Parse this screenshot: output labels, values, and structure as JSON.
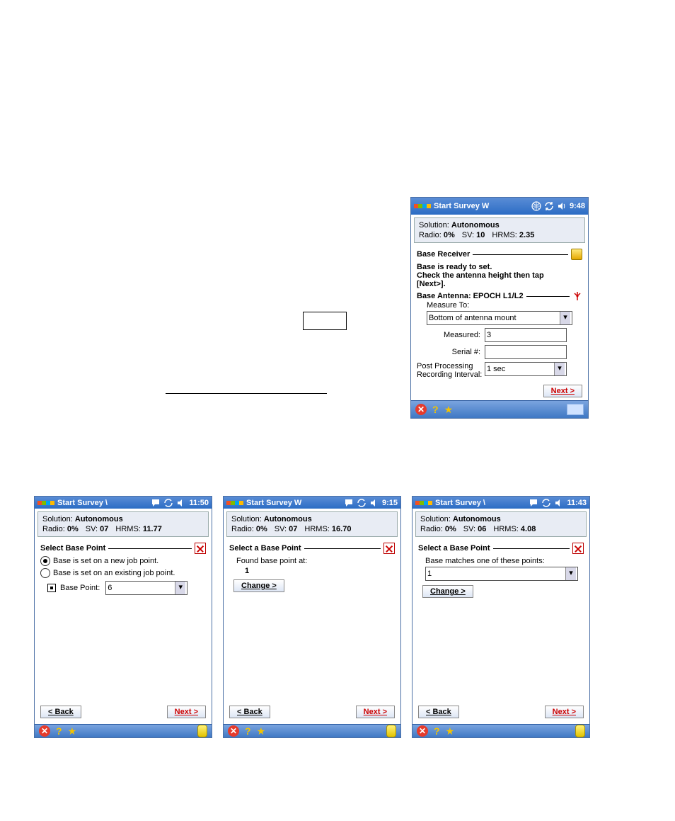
{
  "devices": {
    "top": {
      "title": "Start Survey W",
      "time": "9:48",
      "status": {
        "solution_label": "Solution:",
        "solution_value": "Autonomous",
        "radio_label": "Radio:",
        "radio_value": "0%",
        "sv_label": "SV:",
        "sv_value": "10",
        "hrms_label": "HRMS:",
        "hrms_value": "2.35"
      },
      "section1_title": "Base Receiver",
      "instruction_line1": "Base is ready to set.",
      "instruction_line2": "Check the antenna height then tap",
      "instruction_line3": "[Next>].",
      "section2_title": "Base Antenna: EPOCH L1/L2",
      "measure_to_label": "Measure To:",
      "measure_to_value": "Bottom of antenna mount",
      "measured_label": "Measured:",
      "measured_value": "3",
      "serial_label": "Serial #:",
      "serial_value": "",
      "pprec_label1": "Post Processing",
      "pprec_label2": "Recording Interval:",
      "pprec_value": "1 sec",
      "next_btn": "Next >"
    },
    "left": {
      "title": "Start Survey \\",
      "time": "11:50",
      "status": {
        "solution_label": "Solution:",
        "solution_value": "Autonomous",
        "radio_label": "Radio:",
        "radio_value": "0%",
        "sv_label": "SV:",
        "sv_value": "07",
        "hrms_label": "HRMS:",
        "hrms_value": "11.77"
      },
      "section_title": "Select Base Point",
      "opt1": "Base is set on a new job point.",
      "opt2": "Base is set on an existing job point.",
      "basepoint_label": "Base Point:",
      "basepoint_value": "6",
      "back_btn": "< Back",
      "next_btn": "Next >"
    },
    "mid": {
      "title": "Start Survey W",
      "time": "9:15",
      "status": {
        "solution_label": "Solution:",
        "solution_value": "Autonomous",
        "radio_label": "Radio:",
        "radio_value": "0%",
        "sv_label": "SV:",
        "sv_value": "07",
        "hrms_label": "HRMS:",
        "hrms_value": "16.70"
      },
      "section_title": "Select a Base Point",
      "found_label": "Found base point at:",
      "found_value": "1",
      "change_btn": "Change >",
      "back_btn": "< Back",
      "next_btn": "Next >"
    },
    "right": {
      "title": "Start Survey \\",
      "time": "11:43",
      "status": {
        "solution_label": "Solution:",
        "solution_value": "Autonomous",
        "radio_label": "Radio:",
        "radio_value": "0%",
        "sv_label": "SV:",
        "sv_value": "06",
        "hrms_label": "HRMS:",
        "hrms_value": "4.08"
      },
      "section_title": "Select a Base Point",
      "match_label": "Base matches one of these points:",
      "match_value": "1",
      "change_btn": "Change >",
      "back_btn": "< Back",
      "next_btn": "Next >"
    }
  },
  "colors": {
    "titlebar_start": "#5a8dd6",
    "titlebar_end": "#2b6cc4",
    "next_red": "#c00"
  }
}
